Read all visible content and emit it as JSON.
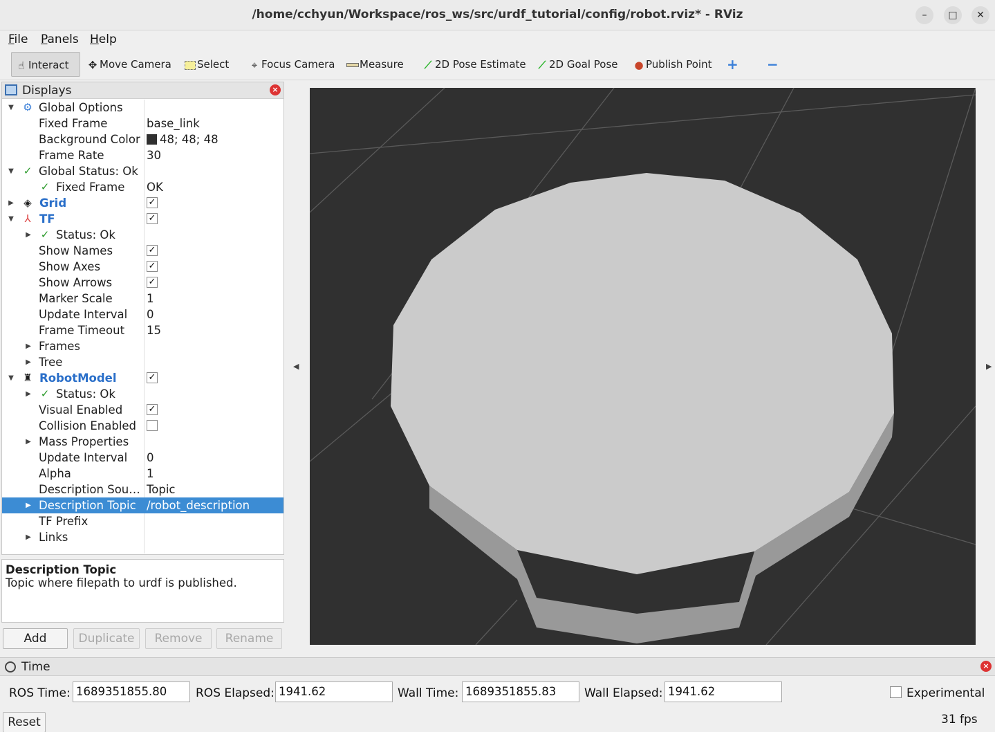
{
  "window": {
    "title": "/home/cchyun/Workspace/ros_ws/src/urdf_tutorial/config/robot.rviz* - RViz",
    "minimize": "–",
    "maximize": "□",
    "close": "✕"
  },
  "menu": [
    {
      "accel": "F",
      "rest": "ile"
    },
    {
      "accel": "P",
      "rest": "anels"
    },
    {
      "accel": "H",
      "rest": "elp"
    }
  ],
  "toolbar": {
    "interact": "Interact",
    "move_camera": "Move Camera",
    "select": "Select",
    "focus_camera": "Focus Camera",
    "measure": "Measure",
    "pose_estimate": "2D Pose Estimate",
    "goal_pose": "2D Goal Pose",
    "publish_point": "Publish Point",
    "add_tool": "+",
    "remove_tool": "−"
  },
  "displays": {
    "title": "Displays",
    "close": "×",
    "rows": {
      "global_options": "Global Options",
      "fixed_frame": {
        "name": "Fixed Frame",
        "value": "base_link"
      },
      "background_color": {
        "name": "Background Color",
        "value": "48; 48; 48"
      },
      "frame_rate": {
        "name": "Frame Rate",
        "value": "30"
      },
      "global_status": "Global Status: Ok",
      "gs_fixed_frame": {
        "name": "Fixed Frame",
        "value": "OK"
      },
      "grid": "Grid",
      "tf": "TF",
      "tf_status": "Status: Ok",
      "show_names": "Show Names",
      "show_axes": "Show Axes",
      "show_arrows": "Show Arrows",
      "marker_scale": {
        "name": "Marker Scale",
        "value": "1"
      },
      "tf_update_interval": {
        "name": "Update Interval",
        "value": "0"
      },
      "frame_timeout": {
        "name": "Frame Timeout",
        "value": "15"
      },
      "frames": "Frames",
      "tree": "Tree",
      "robot_model": "RobotModel",
      "rm_status": "Status: Ok",
      "visual_enabled": "Visual Enabled",
      "collision_enabled": "Collision Enabled",
      "mass_properties": "Mass Properties",
      "rm_update_interval": {
        "name": "Update Interval",
        "value": "0"
      },
      "alpha": {
        "name": "Alpha",
        "value": "1"
      },
      "description_source": {
        "name": "Description Sou…",
        "value": "Topic"
      },
      "description_topic": {
        "name": "Description Topic",
        "value": "/robot_description"
      },
      "tf_prefix": "TF Prefix",
      "links": "Links"
    },
    "checked": {
      "grid": true,
      "tf": true,
      "show_names": true,
      "show_axes": true,
      "show_arrows": true,
      "robot_model": true,
      "visual_enabled": true,
      "collision_enabled": false
    }
  },
  "description": {
    "title": "Description Topic",
    "text": "Topic where filepath to urdf is published."
  },
  "buttons": {
    "add": "Add",
    "duplicate": "Duplicate",
    "remove": "Remove",
    "rename": "Rename"
  },
  "viewport": {
    "background_color": "#303030",
    "cylinder_top_color": "#cbcbcb",
    "cylinder_side_color": "#999999",
    "grid_color": "#5a5a5a"
  },
  "time": {
    "title": "Time",
    "ros_time_label": "ROS Time:",
    "ros_time": "1689351855.80",
    "ros_elapsed_label": "ROS Elapsed:",
    "ros_elapsed": "1941.62",
    "wall_time_label": "Wall Time:",
    "wall_time": "1689351855.83",
    "wall_elapsed_label": "Wall Elapsed:",
    "wall_elapsed": "1941.62",
    "experimental_label": "Experimental",
    "reset": "Reset",
    "fps": "31 fps"
  }
}
